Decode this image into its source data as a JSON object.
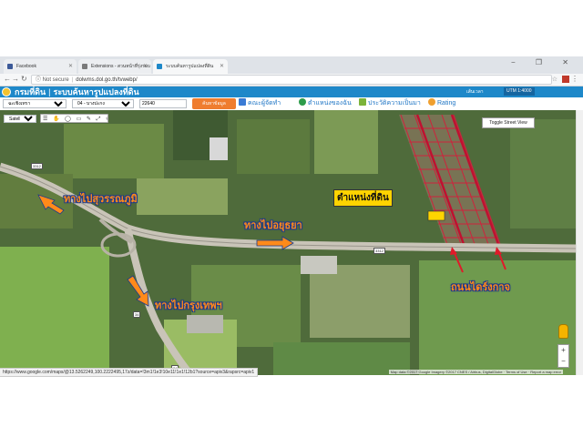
{
  "tabs": [
    {
      "title": "Facebook",
      "favicon_color": "#3b5998"
    },
    {
      "title": "Extensions - สวนหน้าที่รุ่งรอบ",
      "favicon_color": "#7a7a7a"
    },
    {
      "title": "ระบบค้นหารูปแปลงที่ดิน",
      "favicon_color": "#1e88c9"
    }
  ],
  "window_controls": "−  ❐  ✕",
  "address": {
    "security": "Not secure",
    "url": "dolwms.dol.go.th/tvwebp/"
  },
  "site": {
    "title_main": "กรมที่ดิน",
    "title_separator": "|",
    "title_sub": "ระบบค้นหารูปแปลงที่ดิน",
    "coord_text": "เส้นเวลา",
    "scale_text": "UTM 1:4000"
  },
  "toolbar": {
    "province": "ฉะเชิงเทรา",
    "district": "04 - บางปะกง",
    "land_number": "22640",
    "search_label": "ค้นหาข้อมูล",
    "links": [
      {
        "label": "คณะผู้จัดทำ",
        "icon": "people-icon",
        "color": "#3a7bd5"
      },
      {
        "label": "ตำแหน่งของฉัน",
        "icon": "location-icon",
        "color": "#2d9c4b"
      },
      {
        "label": "ประวัติความเป็นมา",
        "icon": "history-icon",
        "color": "#7bb33a"
      },
      {
        "label": "Rating",
        "icon": "rating-icon",
        "color": "#f0a030"
      }
    ]
  },
  "map": {
    "map_type": "Satellite",
    "tools": "☰ ✋ ◯ ▭ ✎ ⤢ ↺ ✕",
    "street_view_label": "Toggle Street View",
    "labels": {
      "to_suvarnabhumi": "ทางไปสุวรรณภูมิ",
      "to_ayutthaya": "ทางไปอยุธยา",
      "to_bangkok": "ทางไปกรุงเทพฯ",
      "plot_location": "ตำแหน่งที่ดิน",
      "road": "ถนนไดร์งกาจ"
    },
    "road_badges": [
      "3312",
      "3312",
      "34",
      "34"
    ],
    "footer": "Map data ©2017 Google Imagery ©2017 CNES / Airbus, DigitalGlobe  ·  Terms of Use  ·  Report a map error",
    "zoom_in": "+",
    "zoom_out": "−"
  },
  "status_url": "https://www.google.com/maps/@13.5262249,100.2222495,17z/data=!3m1!1e3!10e11!1e1!12b1?source=apiv3&rapsrc=apiv1",
  "colors": {
    "header_blue": "#1e88c9",
    "search_orange": "#ef7d2f",
    "label_orange": "#ff8a1a",
    "label_outline": "#1f3a8a",
    "plot_yellow": "#ffd400",
    "parcel_red": "#d81b3a"
  }
}
